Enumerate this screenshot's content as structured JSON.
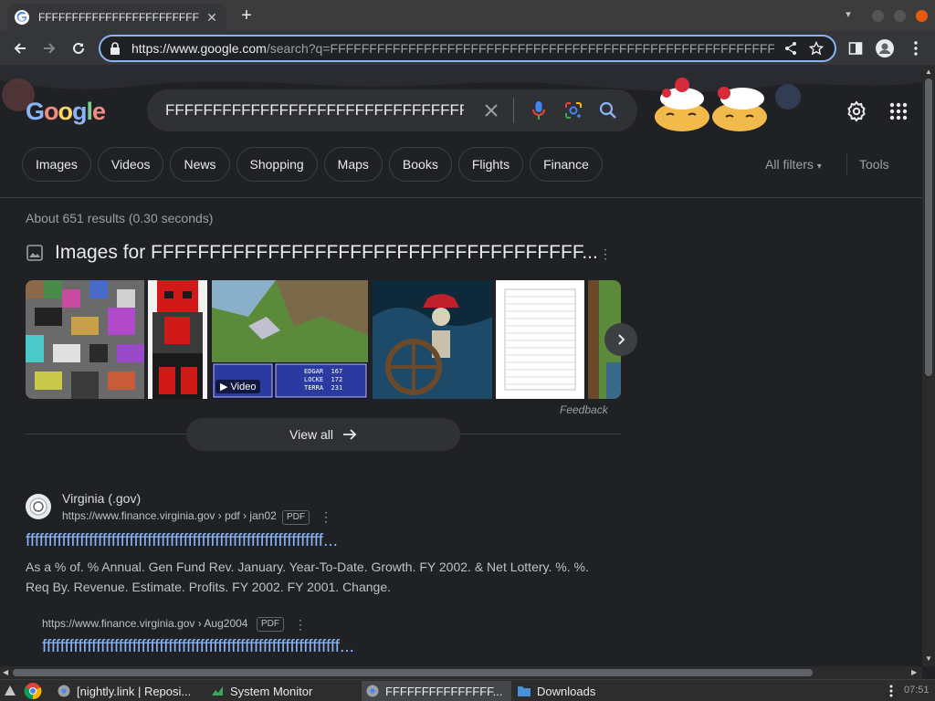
{
  "browser": {
    "tab_title": "FFFFFFFFFFFFFFFFFFFFFFFFFFF",
    "url_host": "https://www.google.com",
    "url_path": "/search?q=FFFFFFFFFFFFFFFFFFFFFFFFFFFFFFFFFFFFFFFFFFFFFFFFFFFFFFFFFFFFFFFFFFFFFFFFFFFFFFFF",
    "accent": "#8ab4f8"
  },
  "search": {
    "logo": "Google",
    "query": "FFFFFFFFFFFFFFFFFFFFFFFFFFFFFFFFFFFFFFFFFFFFF",
    "chips": [
      "Images",
      "Videos",
      "News",
      "Shopping",
      "Maps",
      "Books",
      "Flights",
      "Finance"
    ],
    "all_filters": "All filters",
    "tools": "Tools",
    "stats": "About 651 results (0.30 seconds)"
  },
  "images": {
    "header": "Images for FFFFFFFFFFFFFFFFFFFFFFFFFFFFFFFFFFFFF...",
    "video_badge": "Video",
    "game_stats": [
      {
        "name": "EDGAR",
        "hp": "167"
      },
      {
        "name": "LOCKE",
        "hp": "172"
      },
      {
        "name": "TERRA",
        "hp": "231"
      }
    ],
    "feedback": "Feedback",
    "view_all": "View all"
  },
  "result": {
    "site_name": "Virginia (.gov)",
    "url": "https://www.finance.virginia.gov › pdf › jan02",
    "pdf": "PDF",
    "title": "ffffffffffffffffffffffffffffffffffffffffffffffffffffffffffffffffff...",
    "snippet_1": "As a % of. % Annual. Gen Fund Rev. January. Year-To-Date. Growth. FY 2002. & Net Lottery. %. %.",
    "snippet_2": "Req By. Revenue. Estimate. Profits. FY 2002. FY 2001. Change.",
    "sub_url": "https://www.finance.virginia.gov › Aug2004",
    "sub_pdf": "PDF",
    "sub_title": "ffffffffffffffffffffffffffffffffffffffffffffffffffffffffffffffffff..."
  },
  "taskbar": {
    "items": [
      "[nightly.link | Reposi...",
      "System Monitor",
      "FFFFFFFFFFFFFFF...",
      "Downloads"
    ],
    "clock": "07:51"
  }
}
